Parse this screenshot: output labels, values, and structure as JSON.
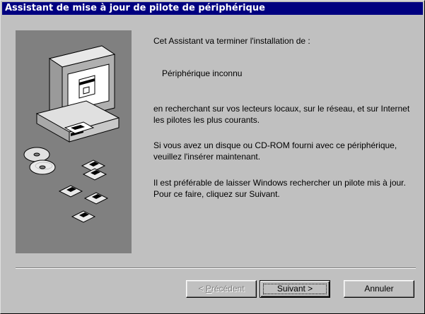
{
  "window": {
    "title": "Assistant de mise à jour de pilote de périphérique"
  },
  "content": {
    "line1": "Cet Assistant va terminer l'installation de :",
    "device_name": "Périphérique inconnu",
    "line3": "en recherchant sur vos lecteurs locaux, sur le réseau, et sur Internet les pilotes les plus courants.",
    "line4": "Si vous avez un disque ou CD-ROM fourni avec ce périphérique, veuillez l'insérer maintenant.",
    "line5": "Il est préférable de laisser Windows rechercher un pilote mis à jour. Pour ce faire, cliquez sur Suivant."
  },
  "buttons": {
    "previous_prefix": "< ",
    "previous_accel": "P",
    "previous_rest": "récédent",
    "next_label": "Suivant >",
    "cancel_label": "Annuler"
  },
  "colors": {
    "titlebar": "#000080",
    "face": "#c0c0c0",
    "art_background": "#808080"
  }
}
